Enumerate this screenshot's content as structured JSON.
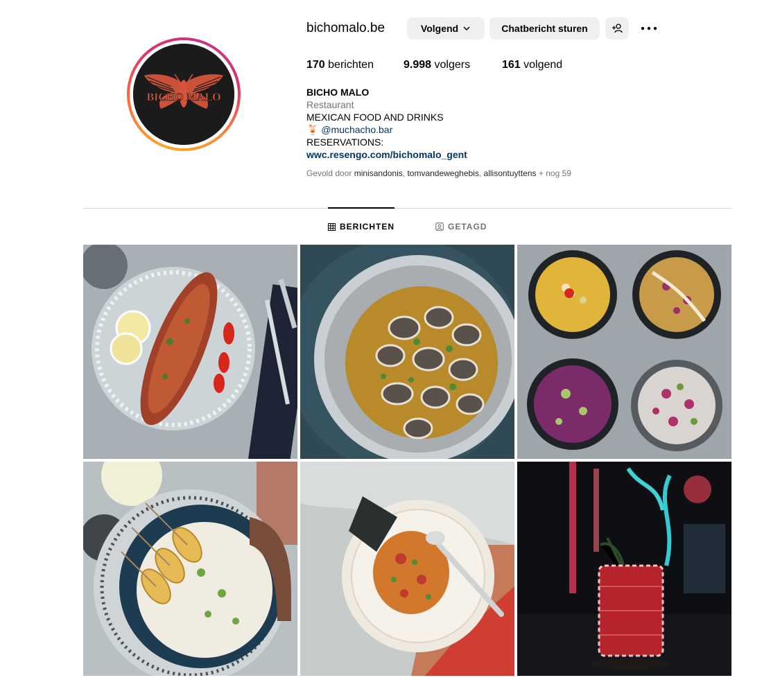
{
  "profile": {
    "username": "bichomalo.be",
    "logo_text": "BICHO MALO",
    "follow_label": "Volgend",
    "message_label": "Chatbericht sturen",
    "stats": {
      "posts_count": "170",
      "posts_label": "berichten",
      "followers_count": "9.998",
      "followers_label": "volgers",
      "following_count": "161",
      "following_label": "volgend"
    },
    "bio": {
      "name": "BICHO MALO",
      "category": "Restaurant",
      "line1": "MEXICAN FOOD AND DRINKS",
      "mention_emoji": "🍹",
      "mention": "@muchacho.bar",
      "line3": "RESERVATIONS:",
      "link": "wwc.resengo.com/bichomalo_gent"
    },
    "followed_by": {
      "prefix": "Gevold door",
      "users": [
        "minisandonis",
        "tomvandeweghebis",
        "allisontuyttens"
      ],
      "more": "+ nog 59"
    }
  },
  "tabs": {
    "posts": "BERICHTEN",
    "tagged": "GETAGD"
  },
  "icons": {
    "follow_chevron": "chevron-down-icon",
    "add_user": "add-user-icon",
    "more": "more-options-icon",
    "posts_tab": "grid-icon",
    "tagged_tab": "tagged-icon"
  },
  "colors": {
    "story_ring_start": "#f9a825",
    "story_ring_end": "#c13584",
    "button_bg": "#efefef",
    "link": "#00376b",
    "muted": "#737373"
  }
}
